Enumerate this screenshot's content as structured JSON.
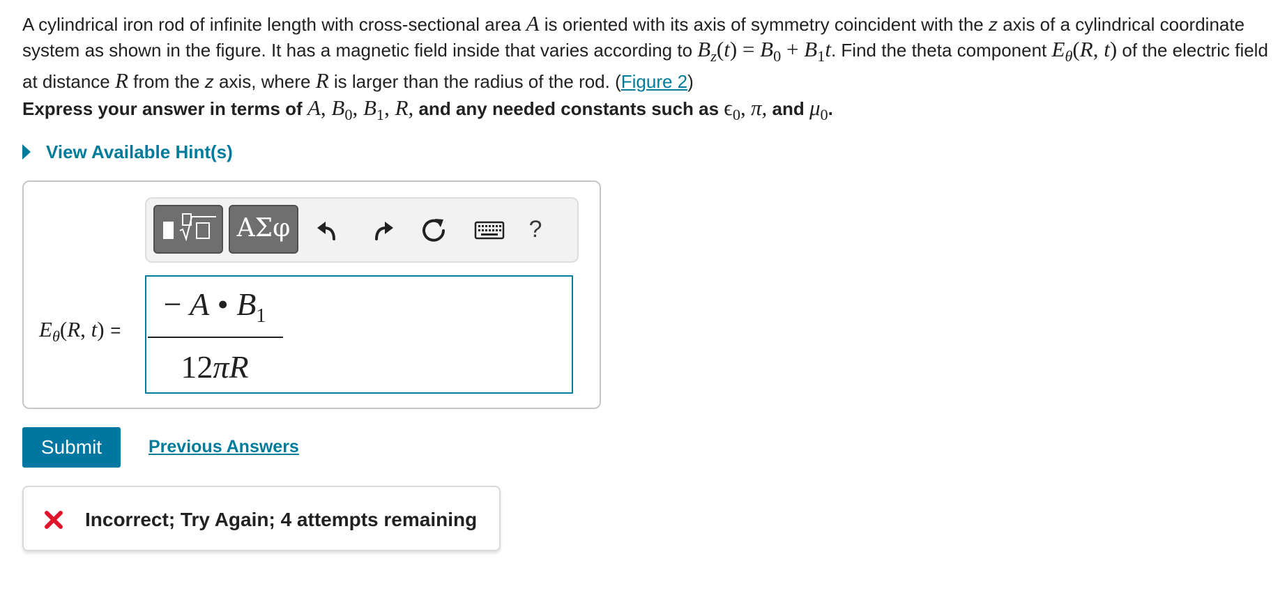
{
  "problem": {
    "text_1": "A cylindrical iron rod of infinite length with cross-sectional area ",
    "var_A": "A",
    "text_2": " is oriented with its axis of symmetry coincident with the ",
    "z_1": "z",
    "text_3": " axis of a cylindrical coordinate system as shown in the figure. It has a magnetic field inside that varies according to ",
    "field_expr": "B_z(t) = B_0 + B_1 t",
    "text_4": ". Find the theta component ",
    "target_expr": "E_θ(R, t)",
    "text_5": " of the electric field at distance ",
    "var_R": "R",
    "text_6": " from the ",
    "z_2": "z",
    "text_7": " axis, where ",
    "var_R2": "R",
    "text_8": " is larger than the radius of the rod. (",
    "figure_link": "Figure 2",
    "text_9": ")"
  },
  "instruction": {
    "text_1": "Express your answer in terms of ",
    "vars": "A, B_0, B_1, R,",
    "text_2": " and any needed constants such as ",
    "c1": "ϵ_0,",
    "c2": "π,",
    "text_3": " and ",
    "c3": "μ_0",
    "text_4": "."
  },
  "hint": {
    "label": "View Available Hint(s)"
  },
  "toolbar": {
    "symbols_label": "ΑΣφ",
    "help_label": "?",
    "icons": [
      "templates-icon",
      "undo-icon",
      "redo-icon",
      "reset-icon",
      "keyboard-icon"
    ]
  },
  "answer": {
    "label": "E_θ(R, t) =",
    "numerator": "− A • B_1",
    "denominator": "12πR"
  },
  "actions": {
    "submit_label": "Submit",
    "previous_answers_label": "Previous Answers"
  },
  "feedback": {
    "text": "Incorrect; Try Again; 4 attempts remaining",
    "status_color": "#e0142d"
  },
  "colors": {
    "link": "#007c9b",
    "submit_bg": "#0077a0",
    "input_border": "#007c9b"
  }
}
